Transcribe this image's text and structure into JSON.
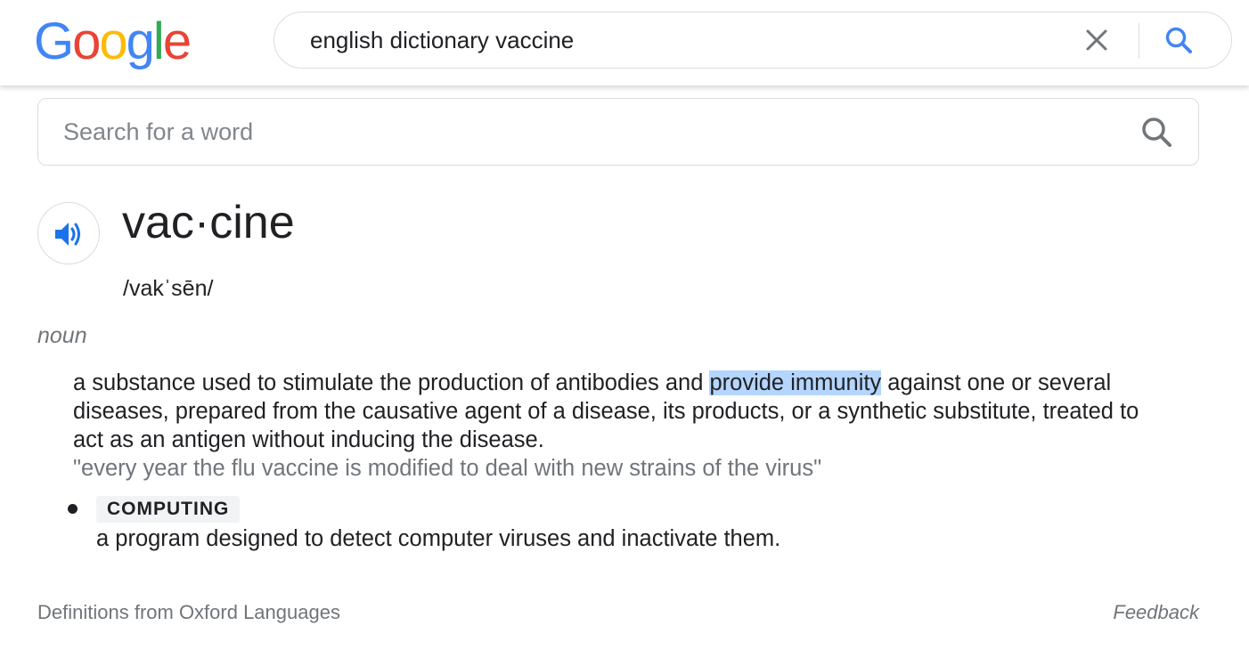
{
  "header": {
    "logo_letters": [
      "G",
      "o",
      "o",
      "g",
      "l",
      "e"
    ],
    "logo_colors": [
      "#4285F4",
      "#EA4335",
      "#FBBC05",
      "#4285F4",
      "#34A853",
      "#EA4335"
    ],
    "search_query": "english dictionary vaccine",
    "clear_icon": "close-icon",
    "search_icon": "search-icon",
    "accent_color": "#4285F4"
  },
  "dictionary": {
    "search_placeholder": "Search for a word",
    "search_icon": "search-icon",
    "audio_icon": "speaker-icon",
    "headword": "vac·cine",
    "phonetic": "/vakˈsēn/",
    "part_of_speech": "noun",
    "definition_before": "a substance used to stimulate the production of antibodies and ",
    "definition_highlight": "provide immunity",
    "definition_after": " against one or several diseases, prepared from the causative agent of a disease, its products, or a synthetic substitute, treated to act as an antigen without inducing the disease.",
    "highlight_color": "#B4D5FE",
    "example": "\"every year the flu vaccine is modified to deal with new strains of the virus\"",
    "sense2_domain": "COMPUTING",
    "sense2_definition": "a program designed to detect computer viruses and inactivate them.",
    "source": "Definitions from Oxford Languages",
    "feedback": "Feedback"
  }
}
